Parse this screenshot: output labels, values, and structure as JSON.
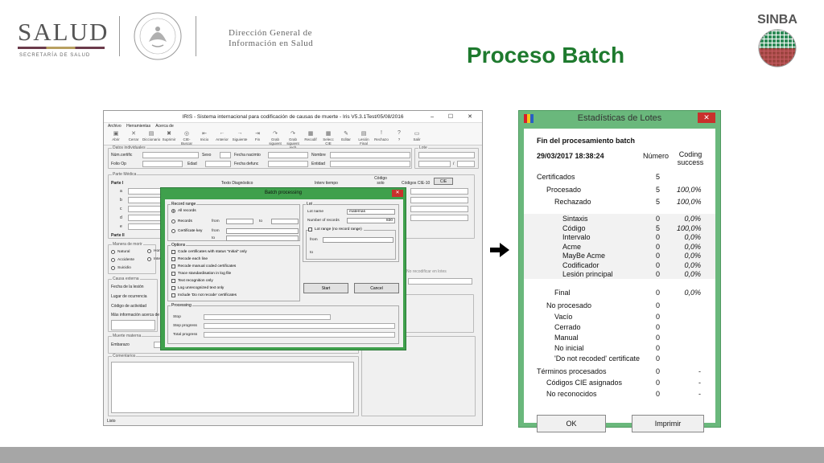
{
  "header": {
    "salud_logo": "SALUD",
    "salud_sub": "SECRETARÍA DE SALUD",
    "dgis_line1": "Dirección General de",
    "dgis_line2": "Información en Salud",
    "sinba_logo": "SINBA",
    "title": "Proceso Batch"
  },
  "iris": {
    "title": "IRIS - Sistema internacional para codificación de causas de muerte - Iris V5.3.1Test/05/08/2016",
    "window_controls": "– ☐ ✕",
    "menu": [
      "Archivo",
      "Herramientas",
      "Acerca de"
    ],
    "toolbar": [
      {
        "icon": "open-icon",
        "glyph": "▣",
        "label": "Abrir"
      },
      {
        "icon": "close-doc-icon",
        "glyph": "✕",
        "label": "Cerrar"
      },
      {
        "icon": "dictionary-icon",
        "glyph": "▤",
        "label": "Diccionario"
      },
      {
        "icon": "delete-icon",
        "glyph": "✖",
        "label": "Suprimir"
      },
      {
        "icon": "cie-search-icon",
        "glyph": "◎",
        "label": "CIE-Buscar"
      },
      {
        "icon": "first-icon",
        "glyph": "⇤",
        "label": "Inicio"
      },
      {
        "icon": "prev-icon",
        "glyph": "←",
        "label": "Anterior"
      },
      {
        "icon": "next-icon",
        "glyph": "→",
        "label": "Siguiente"
      },
      {
        "icon": "last-icon",
        "glyph": "⇥",
        "label": "Fin"
      },
      {
        "icon": "save-next-icon",
        "glyph": "↷",
        "label": "Grab siguient"
      },
      {
        "icon": "save-next-rech-icon",
        "glyph": "↷",
        "label": "Grab siguient rech"
      },
      {
        "icon": "recode-icon",
        "glyph": "▦",
        "label": "Recodif"
      },
      {
        "icon": "select-cie-icon",
        "glyph": "▦",
        "label": "Selecc CIE"
      },
      {
        "icon": "edit-icon",
        "glyph": "✎",
        "label": "Editar"
      },
      {
        "icon": "final-read-icon",
        "glyph": "▤",
        "label": "Lesión Final"
      },
      {
        "icon": "reject-icon",
        "glyph": "!",
        "label": "Rechazo"
      },
      {
        "icon": "help-icon",
        "glyph": "?",
        "label": "?"
      },
      {
        "icon": "exit-icon",
        "glyph": "▭",
        "label": "Salir"
      }
    ],
    "datos_individuales": "Datos individuales",
    "num_certific": "Núm.certific",
    "sexo": "Sexo",
    "fecha_nacim": "Fecha nacimto",
    "nombre": "Nombre",
    "lote": "Lote",
    "folio_op": "Folio Op",
    "edad": "Edad",
    "fecha_defunc": "Fecha defunc",
    "entidad": "Entidad",
    "lote_slash": "/",
    "parte_medica": "Parte Médica",
    "parte_i": "Parte I",
    "texto_diag": "Texto Diagnóstico",
    "interv_tiempo": "Interv tiempo",
    "codigo_solo": "Código solo",
    "codigos_cie10": "Códigos CIE-10",
    "cie_btn": "CIE",
    "rows": [
      "a",
      "b",
      "c",
      "d",
      "e"
    ],
    "parte_ii": "Parte II",
    "manera_morir": "Manera de morir",
    "natural": "Natural",
    "accidente": "Accidente",
    "suicidio": "Suicidio",
    "homicidio": "Hom",
    "inter": "Inter",
    "causa_externa": "Causa externa",
    "fecha_lesion": "Fecha de la lesión",
    "lugar_ocurrencia": "Lugar de ocurrencia",
    "codigo_actividad": "Código de actividad",
    "mas_info": "Más información acerca de",
    "no_recodificar": "No recodificar en lotes",
    "muerte_materna": "Muerte materna",
    "embarazo": "Embarazo",
    "comentarios": "Comentarios",
    "status": "Listo"
  },
  "batch": {
    "title": "Batch processing",
    "close": "✕",
    "record_range": "Record range",
    "all_records": "All records",
    "records": "Records",
    "from": "from",
    "to": "to",
    "certificate_key": "Certificate key",
    "lot": "Lot",
    "lot_name": "Lot name",
    "lot_name_value": "maternas",
    "number_records": "Number of records",
    "number_records_value": "830",
    "lot_range": "Lot range (no record range)",
    "options": "Options",
    "option_items": [
      "Code certificates with status \"Initial\" only",
      "Recode each line",
      "Recode manual coded certificates",
      "Trace standardisation in log file",
      "Text recognition only",
      "Log unrecognized text only",
      "Include 'Do not recode' certificates"
    ],
    "start": "Start",
    "cancel": "Cancel",
    "processing": "Processing",
    "stop": "Stop",
    "step_progress": "Step progress",
    "total_progress": "Total progress"
  },
  "stats": {
    "title": "Estadísticas de Lotes",
    "close": "✕",
    "heading": "Fin del procesamiento batch",
    "datetime": "29/03/2017 18:38:24",
    "col_numero": "Número",
    "col_coding_1": "Coding",
    "col_coding_2": "success",
    "rows": [
      {
        "label": "Certificados",
        "indent": 0,
        "num": "5",
        "pct": ""
      },
      {
        "label": "Procesado",
        "indent": 1,
        "num": "5",
        "pct": "100,0%"
      },
      {
        "label": "Rechazado",
        "indent": 2,
        "num": "5",
        "pct": "100,0%"
      },
      {
        "label": "Sintaxis",
        "indent": 3,
        "num": "0",
        "pct": "0,0%",
        "hl": true
      },
      {
        "label": "Código",
        "indent": 3,
        "num": "5",
        "pct": "100,0%",
        "hl": true
      },
      {
        "label": "Intervalo",
        "indent": 3,
        "num": "0",
        "pct": "0,0%",
        "hl": true
      },
      {
        "label": "Acme",
        "indent": 3,
        "num": "0",
        "pct": "0,0%",
        "hl": true
      },
      {
        "label": "MayBe Acme",
        "indent": 3,
        "num": "0",
        "pct": "0,0%",
        "hl": true
      },
      {
        "label": "Codificador",
        "indent": 3,
        "num": "0",
        "pct": "0,0%",
        "hl": true
      },
      {
        "label": "Lesión principal",
        "indent": 3,
        "num": "0",
        "pct": "0,0%",
        "hl": true
      },
      {
        "label": "Final",
        "indent": 2,
        "num": "0",
        "pct": "0,0%"
      },
      {
        "label": "No procesado",
        "indent": 1,
        "num": "0",
        "pct": ""
      },
      {
        "label": "Vacío",
        "indent": 2,
        "num": "0",
        "pct": ""
      },
      {
        "label": "Cerrado",
        "indent": 2,
        "num": "0",
        "pct": ""
      },
      {
        "label": "Manual",
        "indent": 2,
        "num": "0",
        "pct": ""
      },
      {
        "label": "No inicial",
        "indent": 2,
        "num": "0",
        "pct": ""
      },
      {
        "label": "'Do not recoded' certificate",
        "indent": 2,
        "num": "0",
        "pct": ""
      },
      {
        "label": "Términos procesados",
        "indent": 0,
        "num": "0",
        "pct": "-"
      },
      {
        "label": "Códigos CIE asignados",
        "indent": 1,
        "num": "0",
        "pct": "-"
      },
      {
        "label": "No reconocidos",
        "indent": 1,
        "num": "0",
        "pct": "-"
      }
    ],
    "ok": "OK",
    "print": "Imprimir"
  },
  "colors": {
    "title_green": "#1e7a2e",
    "batch_border": "#3fa04c",
    "stats_border": "#6ab87c",
    "close_red": "#c9302c",
    "footer_gray": "#a6a6a6"
  }
}
